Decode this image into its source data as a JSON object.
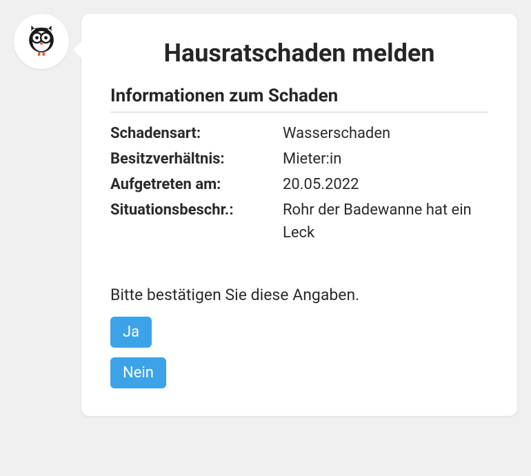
{
  "header": {
    "title": "Hausratschaden melden"
  },
  "section": {
    "subtitle": "Informationen zum Schaden"
  },
  "fields": {
    "type": {
      "label": "Schadensart:",
      "value": "Wasserschaden"
    },
    "ownership": {
      "label": "Besitzverhältnis:",
      "value": "Mieter:in"
    },
    "date": {
      "label": "Aufgetreten am:",
      "value": "20.05.2022"
    },
    "situation": {
      "label": "Situationsbeschr.:",
      "value": "Rohr der Badewanne hat ein Leck"
    }
  },
  "prompt": "Bitte bestätigen Sie diese Angaben.",
  "buttons": {
    "yes": "Ja",
    "no": "Nein"
  }
}
